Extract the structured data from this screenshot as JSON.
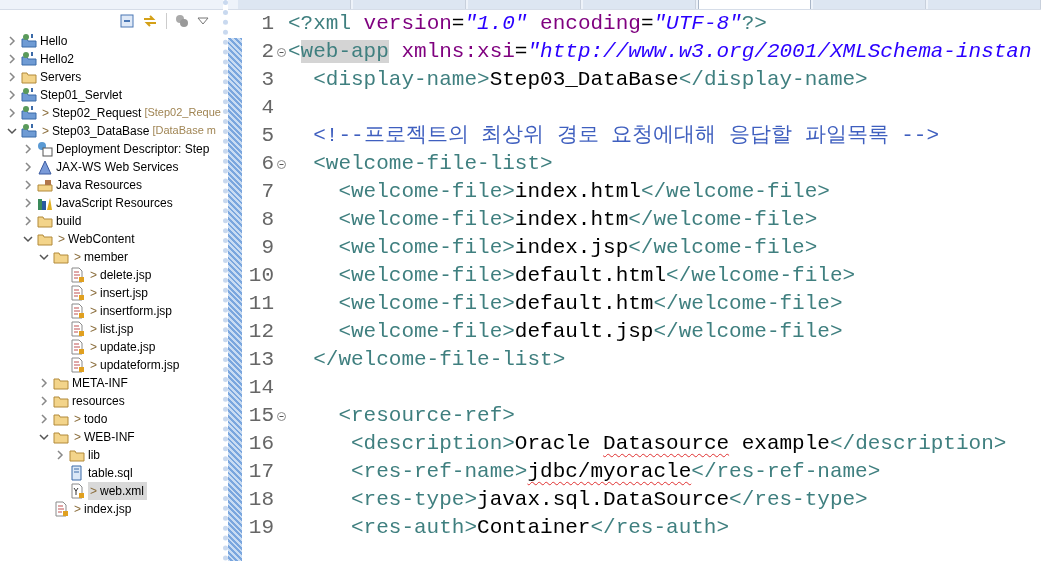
{
  "project_explorer": {
    "tree": [
      {
        "label": "Hello",
        "kind": "project",
        "expanded": false,
        "selected": false
      },
      {
        "label": "Hello2",
        "kind": "project",
        "expanded": false,
        "selected": false
      },
      {
        "label": "Servers",
        "kind": "folder",
        "expanded": false,
        "selected": false
      },
      {
        "label": "Step01_Servlet",
        "kind": "project",
        "expanded": false,
        "selected": false
      },
      {
        "label": "Step02_Request",
        "prefix": ">",
        "suffix": "[Step02_Reque",
        "kind": "project",
        "expanded": false,
        "selected": false
      },
      {
        "label": "Step03_DataBase",
        "prefix": ">",
        "suffix": "[DataBase m",
        "kind": "project",
        "expanded": true,
        "selected": false,
        "children": [
          {
            "label": "Deployment Descriptor: Step",
            "kind": "descriptor",
            "expanded": false,
            "selected": false
          },
          {
            "label": "JAX-WS Web Services",
            "kind": "services",
            "expanded": false,
            "selected": false
          },
          {
            "label": "Java Resources",
            "kind": "java",
            "expanded": false,
            "selected": false
          },
          {
            "label": "JavaScript Resources",
            "kind": "books",
            "expanded": false,
            "selected": false
          },
          {
            "label": "build",
            "kind": "folder",
            "expanded": false,
            "selected": false
          },
          {
            "label": "WebContent",
            "prefix": ">",
            "kind": "folder",
            "expanded": true,
            "selected": false,
            "children": [
              {
                "label": "member",
                "prefix": ">",
                "kind": "folder",
                "expanded": true,
                "selected": false,
                "children": [
                  {
                    "label": "delete.jsp",
                    "prefix": ">",
                    "kind": "file",
                    "selected": false
                  },
                  {
                    "label": "insert.jsp",
                    "prefix": ">",
                    "kind": "file",
                    "selected": false
                  },
                  {
                    "label": "insertform.jsp",
                    "prefix": ">",
                    "kind": "file",
                    "selected": false
                  },
                  {
                    "label": "list.jsp",
                    "prefix": ">",
                    "kind": "file",
                    "selected": false
                  },
                  {
                    "label": "update.jsp",
                    "prefix": ">",
                    "kind": "file",
                    "selected": false
                  },
                  {
                    "label": "updateform.jsp",
                    "prefix": ">",
                    "kind": "file",
                    "selected": false
                  }
                ]
              },
              {
                "label": "META-INF",
                "kind": "folder",
                "expanded": false,
                "selected": false
              },
              {
                "label": "resources",
                "kind": "folder",
                "expanded": false,
                "selected": false
              },
              {
                "label": "todo",
                "prefix": ">",
                "kind": "folder",
                "expanded": false,
                "selected": false
              },
              {
                "label": "WEB-INF",
                "prefix": ">",
                "kind": "folder",
                "expanded": true,
                "selected": false,
                "children": [
                  {
                    "label": "lib",
                    "kind": "folder",
                    "expanded": false,
                    "selected": false
                  },
                  {
                    "label": "table.sql",
                    "kind": "sql",
                    "selected": false
                  },
                  {
                    "label": "web.xml",
                    "prefix": ">",
                    "kind": "xml",
                    "selected": true
                  }
                ]
              },
              {
                "label": "index.jsp",
                "prefix": ">",
                "kind": "file",
                "selected": false
              }
            ]
          }
        ]
      }
    ]
  },
  "editor": {
    "tabs": [
      {
        "selected": false
      },
      {
        "selected": false
      },
      {
        "selected": false
      },
      {
        "selected": false
      },
      {
        "selected": true
      },
      {
        "selected": false
      },
      {
        "selected": false
      }
    ],
    "lines": [
      {
        "number": "1",
        "fold": false,
        "segments": [
          {
            "kind": "tag",
            "text": "<?xml"
          },
          {
            "kind": "attr",
            "text": " version"
          },
          {
            "kind": "plain",
            "text": "="
          },
          {
            "kind": "string",
            "text": "\"1.0\""
          },
          {
            "kind": "attr",
            "text": " encoding"
          },
          {
            "kind": "plain",
            "text": "="
          },
          {
            "kind": "string",
            "text": "\"UTF-8\""
          },
          {
            "kind": "tag",
            "text": "?>"
          }
        ]
      },
      {
        "number": "2",
        "fold": true,
        "segments": [
          {
            "kind": "tag",
            "text": "<"
          },
          {
            "kind": "tag",
            "text": "web-app",
            "highlighted": true
          },
          {
            "kind": "attr",
            "text": " xmlns:xsi"
          },
          {
            "kind": "plain",
            "text": "="
          },
          {
            "kind": "string",
            "text": "\"http://www.w3.org/2001/XMLSchema-instan"
          }
        ]
      },
      {
        "number": "3",
        "fold": false,
        "segments": [
          {
            "kind": "tag",
            "text": "  <display-name>"
          },
          {
            "kind": "text",
            "text": "Step03_DataBase"
          },
          {
            "kind": "tag",
            "text": "</display-name>"
          }
        ]
      },
      {
        "number": "4",
        "fold": false
      },
      {
        "number": "5",
        "fold": false,
        "segments": [
          {
            "kind": "comment",
            "text": "  <!--프로젝트의 최상위 경로 요청에대해 응답할 파일목록 -->"
          }
        ]
      },
      {
        "number": "6",
        "fold": true,
        "segments": [
          {
            "kind": "tag",
            "text": "  <welcome-file-list>"
          }
        ]
      },
      {
        "number": "7",
        "fold": false,
        "segments": [
          {
            "kind": "tag",
            "text": "    <welcome-file>"
          },
          {
            "kind": "text",
            "text": "index.html"
          },
          {
            "kind": "tag",
            "text": "</welcome-file>"
          }
        ]
      },
      {
        "number": "8",
        "fold": false,
        "segments": [
          {
            "kind": "tag",
            "text": "    <welcome-file>"
          },
          {
            "kind": "text",
            "text": "index.htm"
          },
          {
            "kind": "tag",
            "text": "</welcome-file>"
          }
        ]
      },
      {
        "number": "9",
        "fold": false,
        "segments": [
          {
            "kind": "tag",
            "text": "    <welcome-file>"
          },
          {
            "kind": "text",
            "text": "index.jsp"
          },
          {
            "kind": "tag",
            "text": "</welcome-file>"
          }
        ]
      },
      {
        "number": "10",
        "fold": false,
        "segments": [
          {
            "kind": "tag",
            "text": "    <welcome-file>"
          },
          {
            "kind": "text",
            "text": "default.html"
          },
          {
            "kind": "tag",
            "text": "</welcome-file>"
          }
        ]
      },
      {
        "number": "11",
        "fold": false,
        "segments": [
          {
            "kind": "tag",
            "text": "    <welcome-file>"
          },
          {
            "kind": "text",
            "text": "default.htm"
          },
          {
            "kind": "tag",
            "text": "</welcome-file>"
          }
        ]
      },
      {
        "number": "12",
        "fold": false,
        "segments": [
          {
            "kind": "tag",
            "text": "    <welcome-file>"
          },
          {
            "kind": "text",
            "text": "default.jsp"
          },
          {
            "kind": "tag",
            "text": "</welcome-file>"
          }
        ]
      },
      {
        "number": "13",
        "fold": false,
        "segments": [
          {
            "kind": "tag",
            "text": "  </welcome-file-list>"
          }
        ]
      },
      {
        "number": "14",
        "fold": false
      },
      {
        "number": "15",
        "fold": true,
        "segments": [
          {
            "kind": "tag",
            "text": "    <resource-ref>"
          }
        ]
      },
      {
        "number": "16",
        "fold": false,
        "segments": [
          {
            "kind": "tag",
            "text": "     <description>"
          },
          {
            "kind": "text",
            "text": "Oracle "
          },
          {
            "kind": "text",
            "text": "Datasource",
            "misspelled": true
          },
          {
            "kind": "text",
            "text": " example"
          },
          {
            "kind": "tag",
            "text": "</description>"
          }
        ]
      },
      {
        "number": "17",
        "fold": false,
        "segments": [
          {
            "kind": "tag",
            "text": "     <res-ref-name>"
          },
          {
            "kind": "text",
            "text": "jdbc/myoracle",
            "misspelled": true
          },
          {
            "kind": "tag",
            "text": "</res-ref-name>"
          }
        ]
      },
      {
        "number": "18",
        "fold": false,
        "segments": [
          {
            "kind": "tag",
            "text": "     <res-type>"
          },
          {
            "kind": "text",
            "text": "javax.sql.DataSource"
          },
          {
            "kind": "tag",
            "text": "</res-type>"
          }
        ]
      },
      {
        "number": "19",
        "fold": false,
        "segments": [
          {
            "kind": "tag",
            "text": "     <res-auth>"
          },
          {
            "kind": "text",
            "text": "Container"
          },
          {
            "kind": "tag",
            "text": "</res-auth>"
          }
        ]
      }
    ]
  }
}
